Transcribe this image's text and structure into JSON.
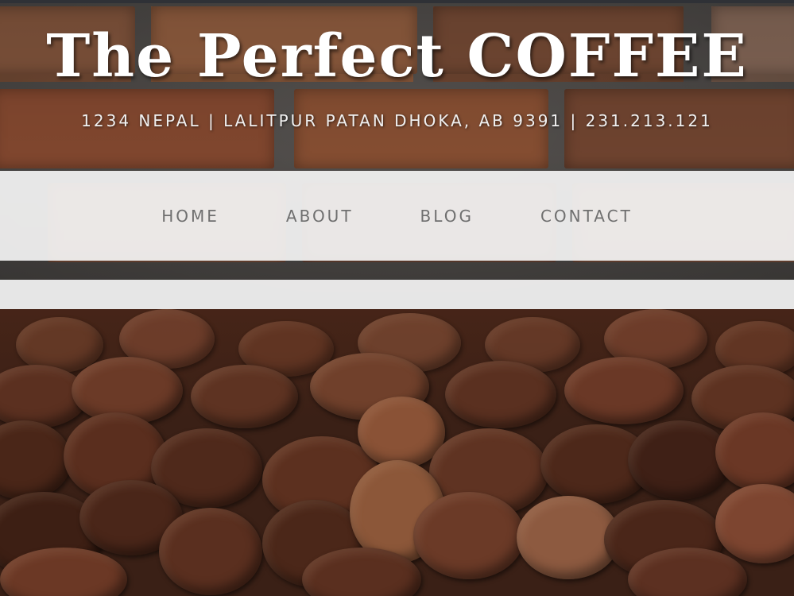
{
  "header": {
    "title": "The Perfect COFFEE",
    "address": "1234 NEPAL | LALITPUR PATAN DHOKA, AB 9391 | 231.213.121"
  },
  "nav": {
    "items": [
      {
        "label": "HOME"
      },
      {
        "label": "ABOUT"
      },
      {
        "label": "BLOG"
      },
      {
        "label": "CONTACT"
      }
    ]
  },
  "colors": {
    "nav_background": "#f5f5f5",
    "nav_text": "#6f6f6f",
    "title_text": "#ffffff",
    "brick": "#8b5a3f",
    "coffee": "#5a3322"
  }
}
